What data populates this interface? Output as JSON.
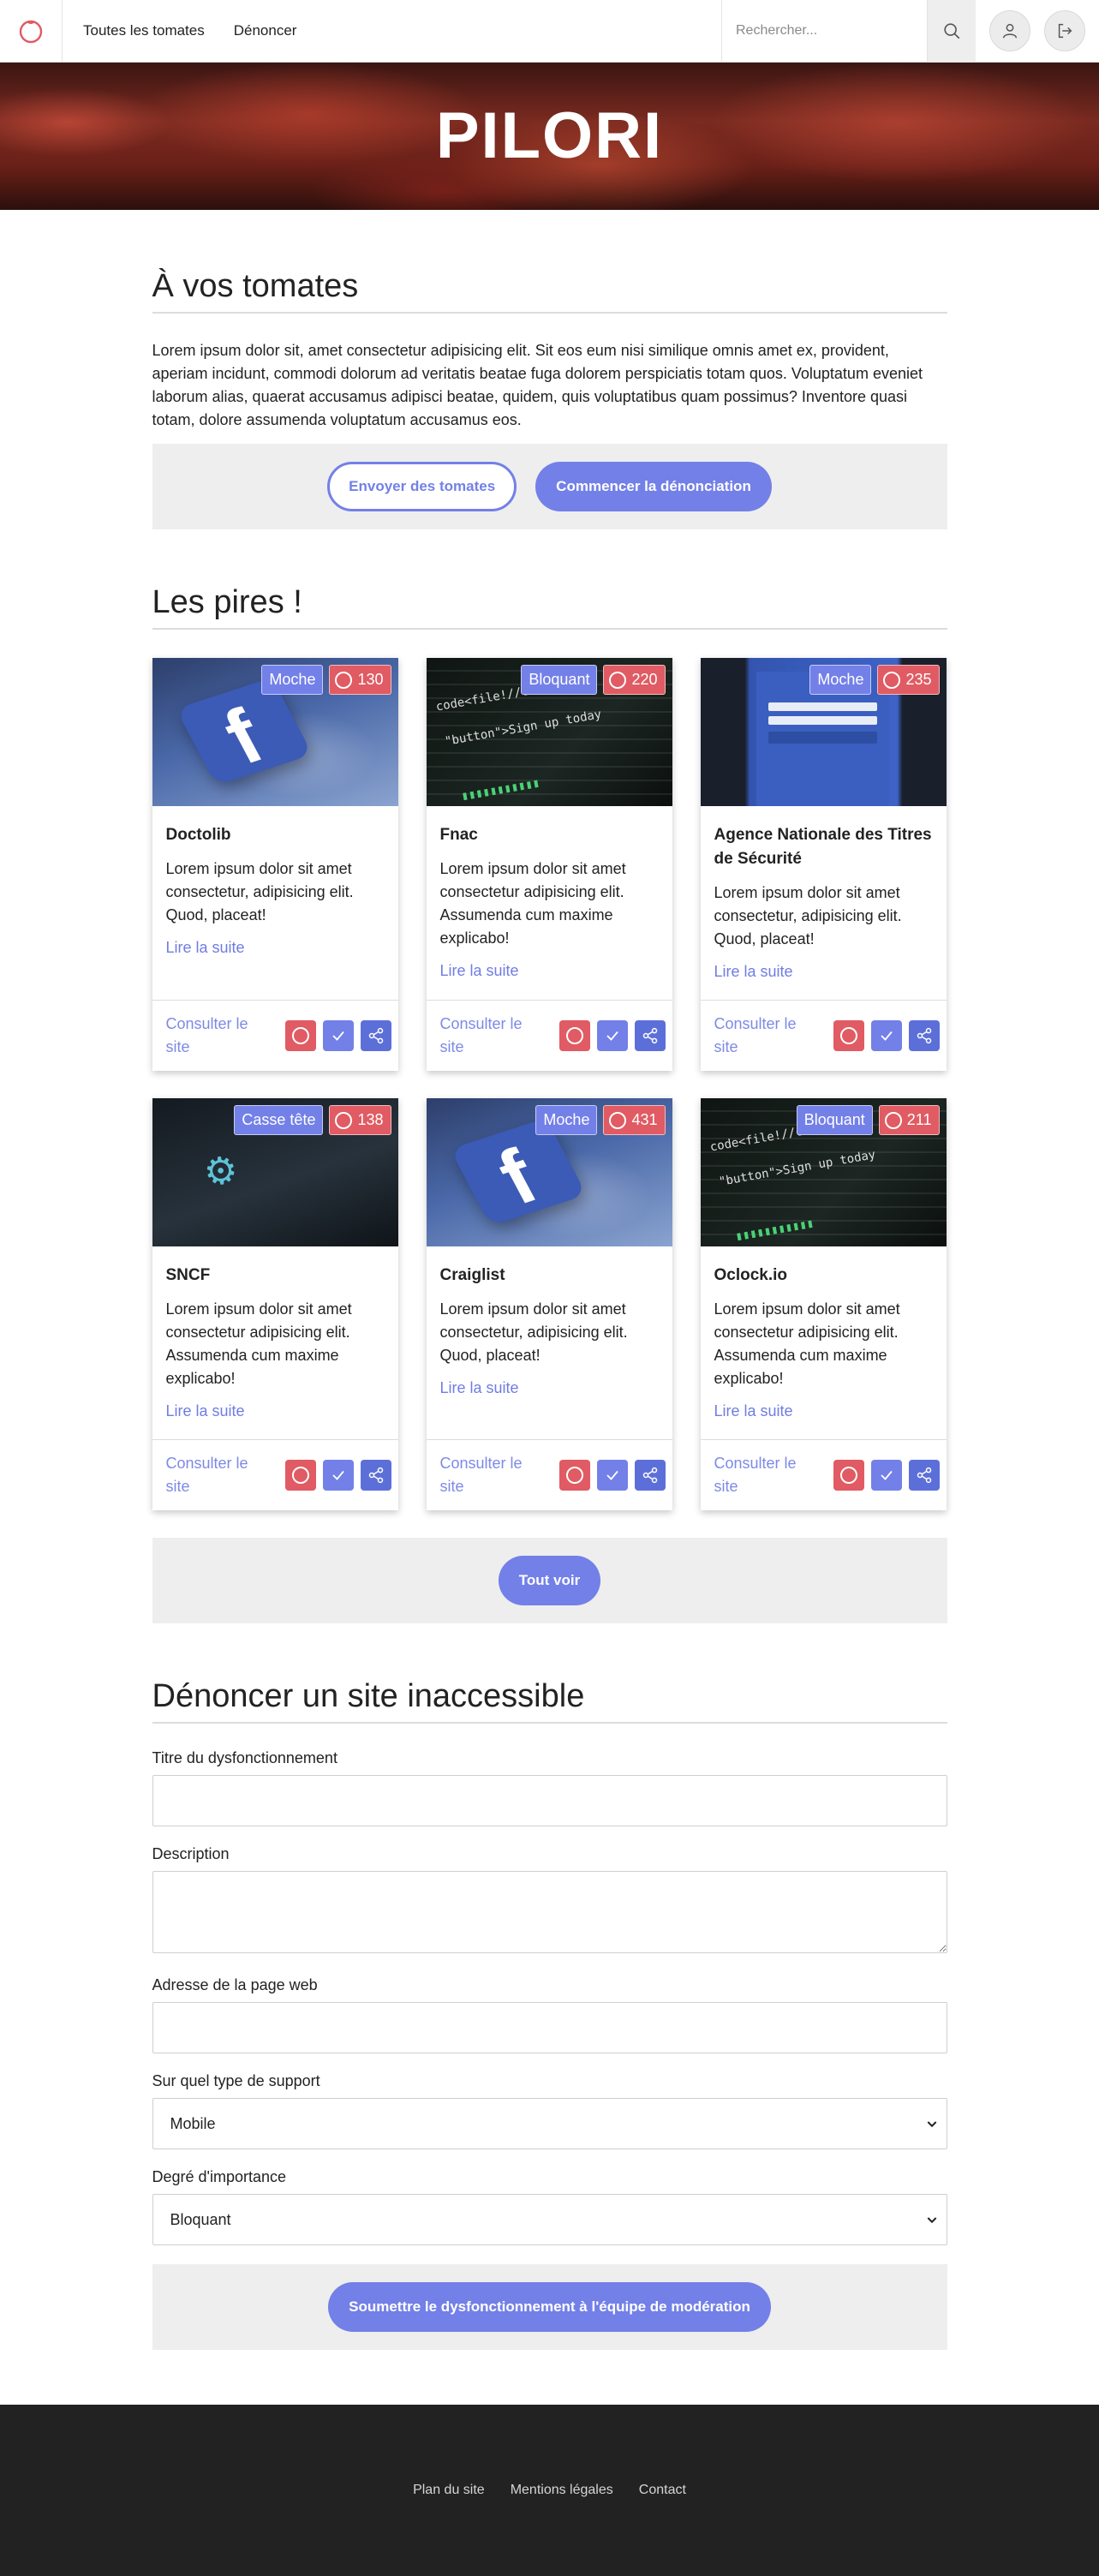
{
  "header": {
    "nav": [
      {
        "label": "Toutes les tomates"
      },
      {
        "label": "Dénoncer"
      }
    ],
    "search_placeholder": "Rechercher..."
  },
  "hero": {
    "title": "PILORI"
  },
  "intro": {
    "title": "À vos tomates",
    "text": "Lorem ipsum dolor sit, amet consectetur adipisicing elit. Sit eos eum nisi similique omnis amet ex, provident, aperiam incidunt, commodi dolorum ad veritatis beatae fuga dolorem perspiciatis totam quos. Voluptatum eveniet laborum alias, quaerat accusamus adipisci beatae, quidem, quis voluptatibus quam possimus? Inventore quasi totam, dolore assumenda voluptatum accusamus eos.",
    "btn_send": "Envoyer des tomates",
    "btn_start": "Commencer la dénonciation"
  },
  "worst": {
    "title": "Les pires !",
    "read_more": "Lire la suite",
    "visit_site": "Consulter le site",
    "see_all": "Tout voir",
    "cards": [
      {
        "title": "Doctolib",
        "type": "Moche",
        "count": "130",
        "text": "Lorem ipsum dolor sit amet consectetur, adipisicing elit. Quod, placeat!",
        "image": "facebook-icon-photo"
      },
      {
        "title": "Fnac",
        "type": "Bloquant",
        "count": "220",
        "text": "Lorem ipsum dolor sit amet consectetur adipisicing elit. Assumenda cum maxime explicabo!",
        "image": "code-screen-photo"
      },
      {
        "title": "Agence Nationale des Titres de Sécurité",
        "type": "Moche",
        "count": "235",
        "text": "Lorem ipsum dolor sit amet consectetur, adipisicing elit. Quod, placeat!",
        "image": "facebook-login-phone-photo"
      },
      {
        "title": "SNCF",
        "type": "Casse tête",
        "count": "138",
        "text": "Lorem ipsum dolor sit amet consectetur adipisicing elit. Assumenda cum maxime explicabo!",
        "image": "settings-screen-photo"
      },
      {
        "title": "Craiglist",
        "type": "Moche",
        "count": "431",
        "text": "Lorem ipsum dolor sit amet consectetur, adipisicing elit. Quod, placeat!",
        "image": "facebook-icon-photo"
      },
      {
        "title": "Oclock.io",
        "type": "Bloquant",
        "count": "211",
        "text": "Lorem ipsum dolor sit amet consectetur adipisicing elit. Assumenda cum maxime explicabo!",
        "image": "code-screen-photo"
      }
    ]
  },
  "report": {
    "title": "Dénoncer un site inaccessible",
    "label_title": "Titre du dysfonctionnement",
    "label_description": "Description",
    "label_url": "Adresse de la page web",
    "label_support": "Sur quel type de support",
    "support_value": "Mobile",
    "label_importance": "Degré d'importance",
    "importance_value": "Bloquant",
    "submit": "Soumettre le dysfonctionnement à l'équipe de modération"
  },
  "footer": {
    "links": [
      {
        "label": "Plan du site"
      },
      {
        "label": "Mentions légales"
      },
      {
        "label": "Contact"
      }
    ]
  },
  "colors": {
    "accent": "#7380e8",
    "tomato": "#e05b63",
    "footer_bg": "#222222"
  }
}
